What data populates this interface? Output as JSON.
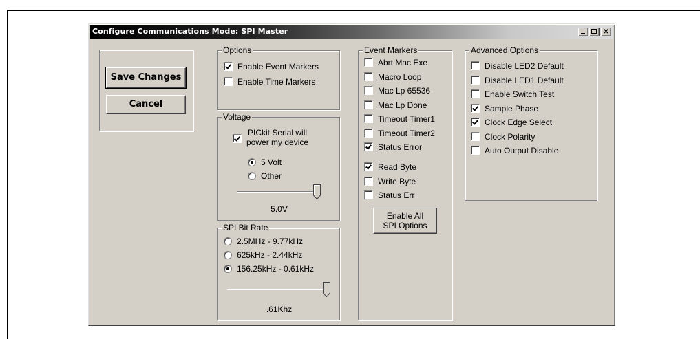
{
  "window": {
    "title": "Configure Communications Mode: SPI Master"
  },
  "actions": {
    "save_label": "Save Changes",
    "cancel_label": "Cancel"
  },
  "options": {
    "title": "Options",
    "items": [
      {
        "label": "Enable Event Markers",
        "checked": true
      },
      {
        "label": "Enable Time Markers",
        "checked": false
      }
    ]
  },
  "voltage": {
    "title": "Voltage",
    "power_label_line1": "PICkit Serial will",
    "power_label_line2": "power my device",
    "power_checked": true,
    "radios": [
      {
        "label": "5 Volt",
        "selected": true
      },
      {
        "label": "Other",
        "selected": false
      }
    ],
    "slider_level": 1.0,
    "value_text": "5.0V"
  },
  "bitrate": {
    "title": "SPI Bit Rate",
    "radios": [
      {
        "label": "2.5MHz - 9.77kHz",
        "selected": false
      },
      {
        "label": "625kHz - 2.44kHz",
        "selected": false
      },
      {
        "label": "156.25kHz - 0.61kHz",
        "selected": true
      }
    ],
    "slider_level": 1.0,
    "value_text": ".61Khz"
  },
  "event_markers": {
    "title": "Event Markers",
    "items": [
      {
        "label": "Abrt Mac Exe",
        "checked": false
      },
      {
        "label": "Macro Loop",
        "checked": false
      },
      {
        "label": "Mac Lp 65536",
        "checked": false
      },
      {
        "label": "Mac Lp Done",
        "checked": false
      },
      {
        "label": "Timeout Timer1",
        "checked": false
      },
      {
        "label": "Timeout Timer2",
        "checked": false
      },
      {
        "label": "Status Error",
        "checked": true
      }
    ],
    "spi_items": [
      {
        "label": "Read Byte",
        "checked": true
      },
      {
        "label": "Write Byte",
        "checked": false
      },
      {
        "label": "Status Err",
        "checked": false
      }
    ],
    "enable_all_line1": "Enable All",
    "enable_all_line2": "SPI Options"
  },
  "advanced": {
    "title": "Advanced Options",
    "items": [
      {
        "label": "Disable LED2 Default",
        "checked": false
      },
      {
        "label": "Disable LED1 Default",
        "checked": false
      },
      {
        "label": "Enable Switch Test",
        "checked": false
      },
      {
        "label": "Sample Phase",
        "checked": true
      },
      {
        "label": "Clock Edge Select",
        "checked": true
      },
      {
        "label": "Clock Polarity",
        "checked": false
      },
      {
        "label": "Auto Output Disable",
        "checked": false
      }
    ]
  }
}
